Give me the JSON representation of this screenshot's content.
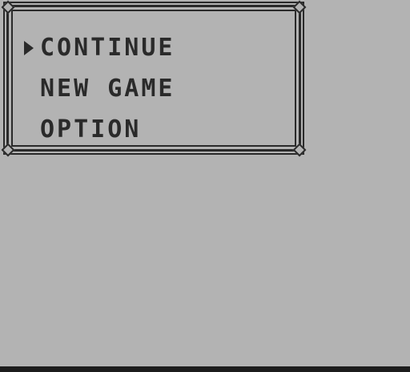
{
  "menu": {
    "items": [
      {
        "label": "CONTINUE",
        "selected": true
      },
      {
        "label": "NEW GAME",
        "selected": false
      },
      {
        "label": "OPTION",
        "selected": false
      }
    ],
    "cursor_icon": "right-triangle-cursor"
  },
  "colors": {
    "background": "#b3b3b3",
    "ink": "#2a2a2a",
    "bottom_bar": "#1c1c1c"
  }
}
